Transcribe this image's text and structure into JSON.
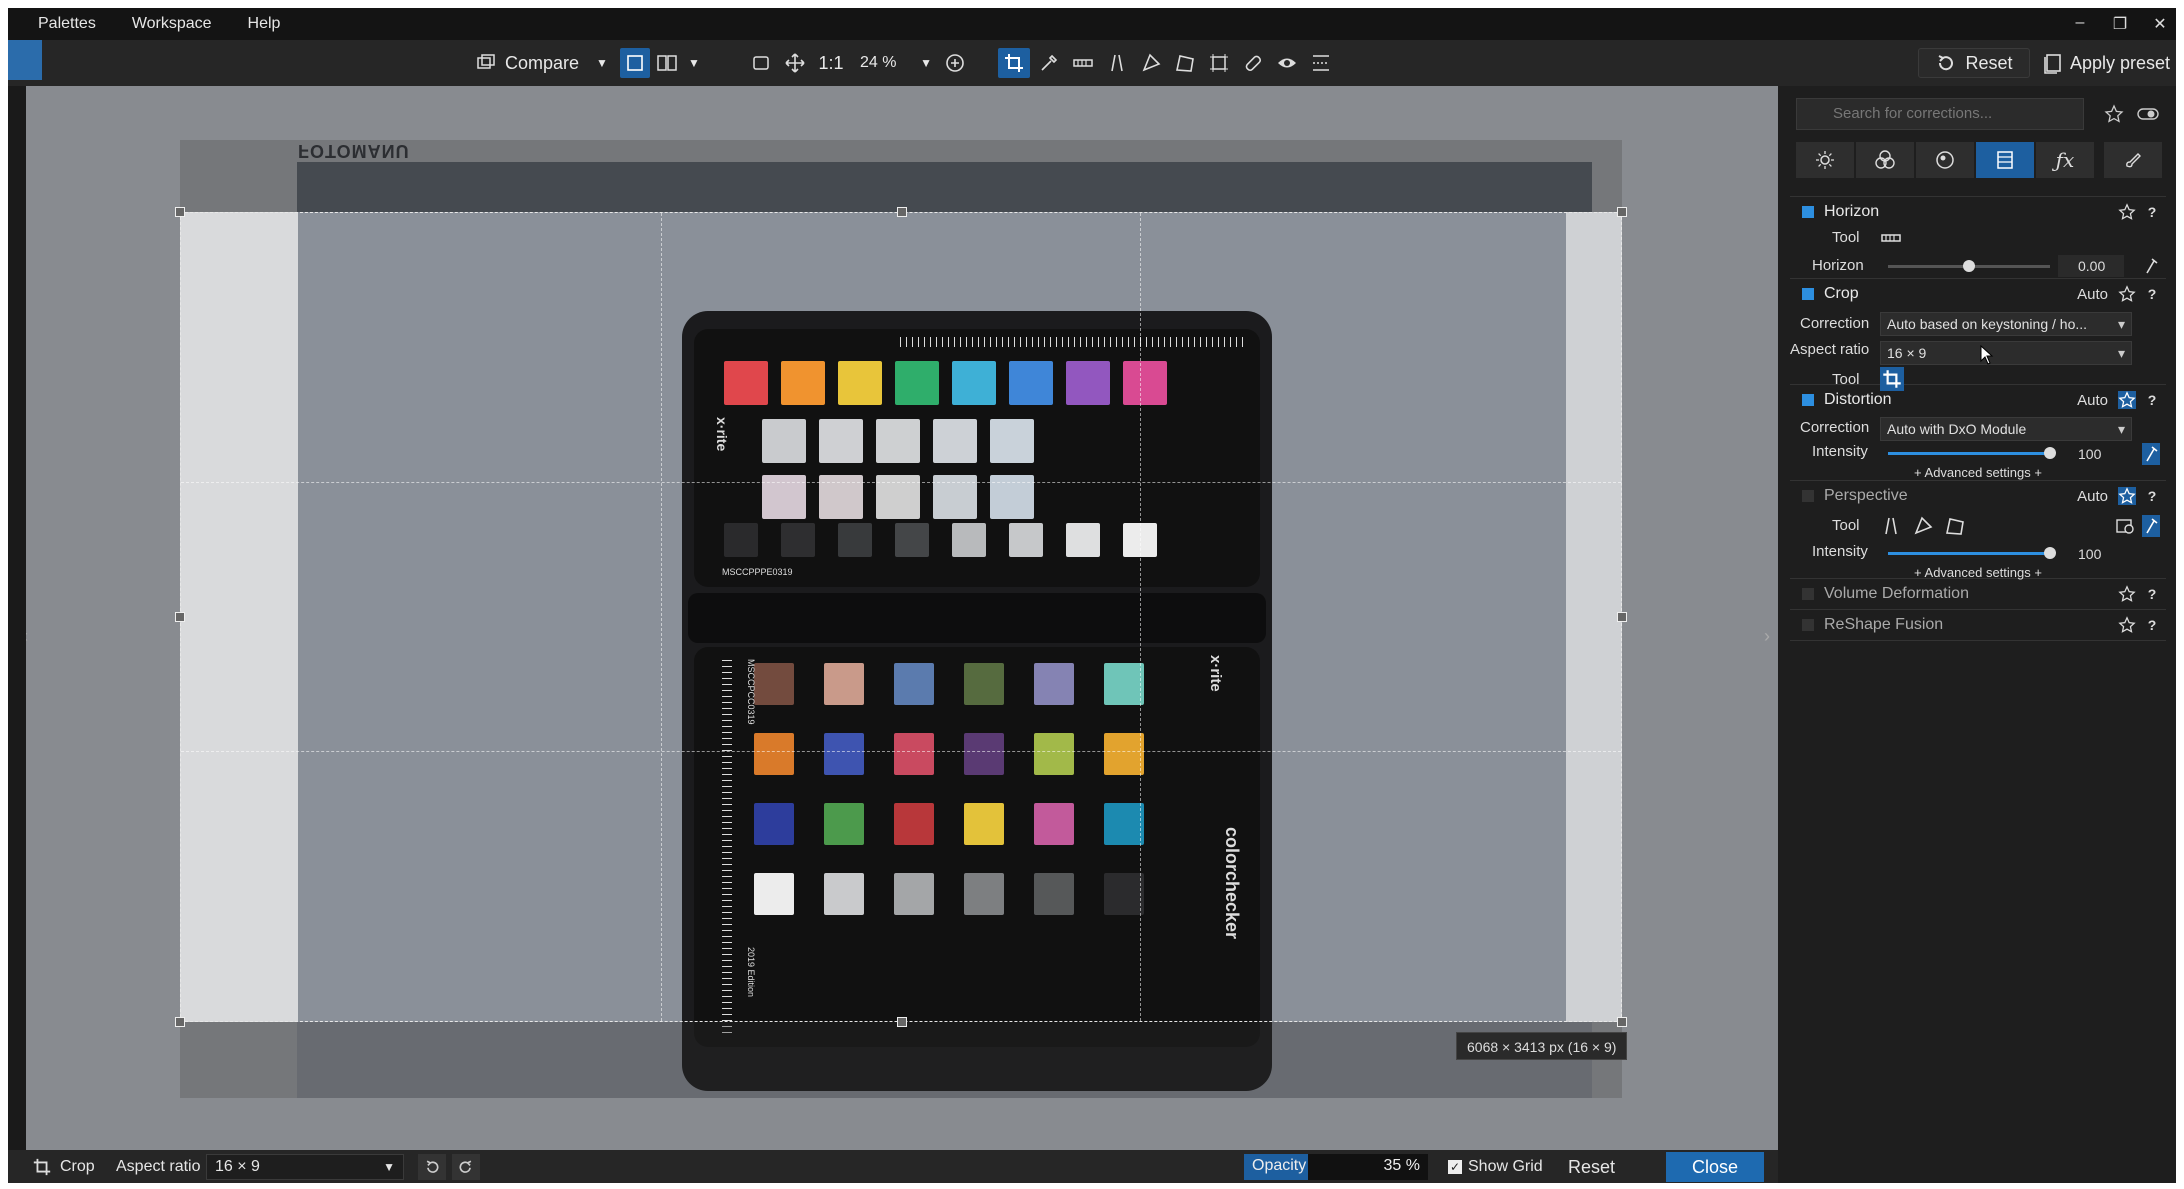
{
  "menu": [
    "Palettes",
    "Workspace",
    "Help"
  ],
  "toolbar": {
    "compare_label": "Compare",
    "one_to_one": "1:1",
    "zoom": "24 %",
    "reset_label": "Reset",
    "apply_preset_label": "Apply preset"
  },
  "viewer": {
    "image_stamp": "FOTOMANU",
    "dimensions": "6068 × 3413 px (16 × 9)",
    "checker_serial_top": "MSCCPPPE0319",
    "checker_serial_bottom": "MSCCPCC0319",
    "checker_brand": "x·rite",
    "checker_product": "colorchecker",
    "checker_edition": "2019 Edition"
  },
  "bottombar": {
    "tool_label": "Crop",
    "aspect_label": "Aspect ratio",
    "aspect_value": "16 × 9",
    "opacity_label": "Opacity",
    "opacity_value": "35 %",
    "opacity_fraction": 0.35,
    "show_grid_label": "Show Grid",
    "show_grid_checked": true,
    "reset_label": "Reset",
    "close_label": "Close"
  },
  "panel": {
    "search_placeholder": "Search for corrections...",
    "horizon": {
      "title": "Horizon",
      "tool_label": "Tool",
      "slider_label": "Horizon",
      "value": "0.00",
      "slider_fraction": 0.5
    },
    "crop": {
      "title": "Crop",
      "auto": "Auto",
      "correction_label": "Correction",
      "correction_value": "Auto based on keystoning / ho...",
      "aspect_label": "Aspect ratio",
      "aspect_value": "16 × 9",
      "tool_label": "Tool"
    },
    "distortion": {
      "title": "Distortion",
      "auto": "Auto",
      "correction_label": "Correction",
      "correction_value": "Auto with DxO Module",
      "intensity_label": "Intensity",
      "intensity_value": "100",
      "intensity_fraction": 1.0,
      "advanced": "+ Advanced settings +"
    },
    "perspective": {
      "title": "Perspective",
      "auto": "Auto",
      "tool_label": "Tool",
      "intensity_label": "Intensity",
      "intensity_value": "100",
      "intensity_fraction": 1.0,
      "advanced": "+ Advanced settings +"
    },
    "volume": {
      "title": "Volume Deformation"
    },
    "reshape": {
      "title": "ReShape Fusion"
    }
  },
  "colors": {
    "accent": "#1d5fa0",
    "checkbox": "#2d8fe0",
    "top_patches": [
      "#e0474c",
      "#f0932f",
      "#e8c53a",
      "#2fae6b",
      "#3eb0d6",
      "#3f86d8",
      "#9257bf",
      "#d94a92"
    ],
    "gray_row1": [
      "#c9cbce",
      "#cfd0d3",
      "#ced0d2",
      "#cdd1d6",
      "#c9d2da"
    ],
    "gray_row2": [
      "#d2c6cf",
      "#d0c8cb",
      "#cfcfcf",
      "#c8cdd2",
      "#c3cdd7"
    ],
    "gray_row3": [
      "#2a2a2c",
      "#2e2e30",
      "#383a3c",
      "#444648",
      "#b8babc",
      "#c6c8ca",
      "#dedfe0",
      "#ececec"
    ],
    "classic": [
      [
        "#734b3e",
        "#c99a8a",
        "#5b7bae",
        "#566b3f",
        "#8583b3",
        "#6fc5b8"
      ],
      [
        "#d97a2a",
        "#3e54b0",
        "#c94a60",
        "#5a3a73",
        "#a2b949",
        "#e2a32e"
      ],
      [
        "#2d3d9c",
        "#4c9a4c",
        "#b8373a",
        "#e3c23a",
        "#c25a9b",
        "#1c8ab0"
      ],
      [
        "#ececec",
        "#c9cacc",
        "#a4a6a8",
        "#7d7f81",
        "#565859",
        "#2b2b2d"
      ]
    ]
  }
}
